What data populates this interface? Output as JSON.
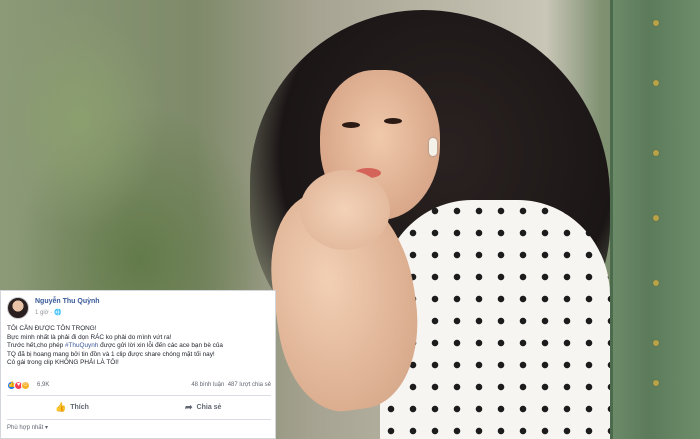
{
  "post": {
    "author": "Nguyễn Thu Quỳnh",
    "time": "1 giờ · 🌐",
    "lines": [
      "TÔI CẦN ĐƯỢC TÔN TRỌNG!",
      "Bực mình nhất là phải đi dọn RÁC ko phải do mình vứt ra!",
      "Trước hết,cho phép ",
      "TQ đã bị hoang mang bởi tin đồn và 1 clip được share chóng mặt tối nay!",
      "Cô gái trong clip KHÔNG PHẢI LÀ TÔI!"
    ],
    "hashtag": "#ThuQuynh",
    "line3_rest": " được gửi lời xin lỗi đến các ace bạn bè của",
    "reactions_count": "6,9K",
    "comments": "48 bình luận",
    "shares": "487 lượt chia sẻ",
    "like_label": "Thích",
    "share_label": "Chia sẻ",
    "sort_label": "Phù hợp nhất ▾"
  },
  "icons": {
    "like": "like-icon",
    "love": "love-icon",
    "haha": "haha-icon",
    "thumb": "thumbs-up-icon",
    "share": "share-arrow-icon"
  },
  "colors": {
    "link": "#385898",
    "like_blue": "#1877f2",
    "love_red": "#f33e58",
    "haha_yellow": "#f7b125"
  }
}
